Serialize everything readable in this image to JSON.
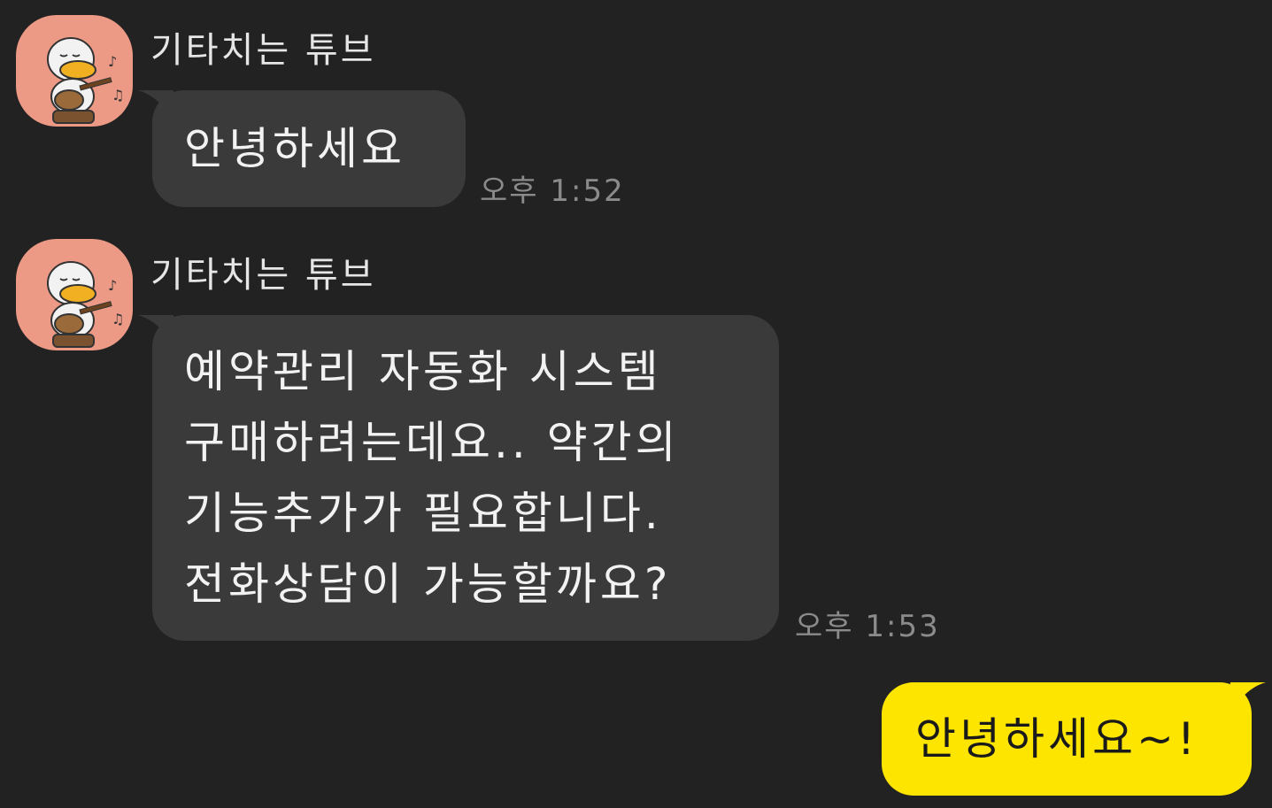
{
  "colors": {
    "background": "#222222",
    "incoming_bubble": "#3a3a3a",
    "outgoing_bubble": "#fee500",
    "avatar_bg": "#ec9a86"
  },
  "messages": [
    {
      "sender": "기타치는 튜브",
      "avatar_icon": "tube-duck-guitar-avatar-icon",
      "text": "안녕하세요",
      "time": "오후 1:52"
    },
    {
      "sender": "기타치는 튜브",
      "avatar_icon": "tube-duck-guitar-avatar-icon",
      "text": "예약관리 자동화 시스템\n구매하려는데요.. 약간의\n기능추가가 필요합니다.\n전화상담이 가능할까요?",
      "time": "오후 1:53"
    },
    {
      "mine": true,
      "text": "안녕하세요~!"
    }
  ]
}
